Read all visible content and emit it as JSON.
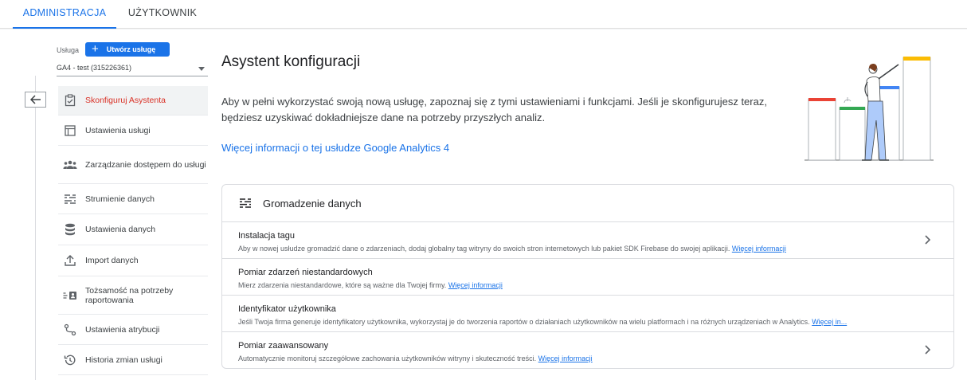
{
  "tabs": [
    {
      "label": "ADMINISTRACJA"
    },
    {
      "label": "UŻYTKOWNIK"
    }
  ],
  "property": {
    "label": "Usługa",
    "create_button": "Utwórz usługę",
    "selected": "GA4 - test (315226361)"
  },
  "nav": {
    "items": [
      {
        "label": "Skonfiguruj Asystenta",
        "icon": "clipboard-check-icon"
      },
      {
        "label": "Ustawienia usługi",
        "icon": "window-icon"
      },
      {
        "label": "Zarządzanie dostępem do usługi",
        "icon": "people-icon"
      },
      {
        "label": "Strumienie danych",
        "icon": "streams-icon"
      },
      {
        "label": "Ustawienia danych",
        "icon": "database-icon"
      },
      {
        "label": "Import danych",
        "icon": "upload-icon"
      },
      {
        "label": "Tożsamość na potrzeby raportowania",
        "icon": "identity-icon"
      },
      {
        "label": "Ustawienia atrybucji",
        "icon": "attribution-icon"
      },
      {
        "label": "Historia zmian usługi",
        "icon": "history-icon"
      }
    ]
  },
  "main": {
    "title": "Asystent konfiguracji",
    "intro": "Aby w pełni wykorzystać swoją nową usługę, zapoznaj się z tymi ustawieniami i funkcjami. Jeśli je skonfigurujesz teraz, będziesz uzyskiwać dokładniejsze dane na potrzeby przyszłych analiz.",
    "more_link": "Więcej informacji o tej usłudze Google Analytics 4"
  },
  "card": {
    "title": "Gromadzenie danych",
    "rows": [
      {
        "title": "Instalacja tagu",
        "desc": "Aby w nowej usłudze gromadzić dane o zdarzeniach, dodaj globalny tag witryny do swoich stron internetowych lub pakiet SDK Firebase do swojej aplikacji.",
        "link": "Więcej informacji",
        "chevron": true
      },
      {
        "title": "Pomiar zdarzeń niestandardowych",
        "desc": "Mierz zdarzenia niestandardowe, które są ważne dla Twojej firmy.",
        "link": "Więcej informacji",
        "chevron": false
      },
      {
        "title": "Identyfikator użytkownika",
        "desc": "Jeśli Twoja firma generuje identyfikatory użytkownika, wykorzystaj je do tworzenia raportów o działaniach użytkowników na wielu platformach i na różnych urządzeniach w Analytics.",
        "link": "Więcej in...",
        "chevron": false
      },
      {
        "title": "Pomiar zaawansowany",
        "desc": "Automatycznie monitoruj szczegółowe zachowania użytkowników witryny i skuteczność treści.",
        "link": "Więcej informacji",
        "chevron": true
      }
    ]
  },
  "colors": {
    "accent": "#1a73e8",
    "active_nav": "#d93025",
    "bar_red": "#ea4335",
    "bar_green": "#34a853",
    "bar_blue": "#4285f4",
    "bar_yellow": "#fbbc04"
  }
}
